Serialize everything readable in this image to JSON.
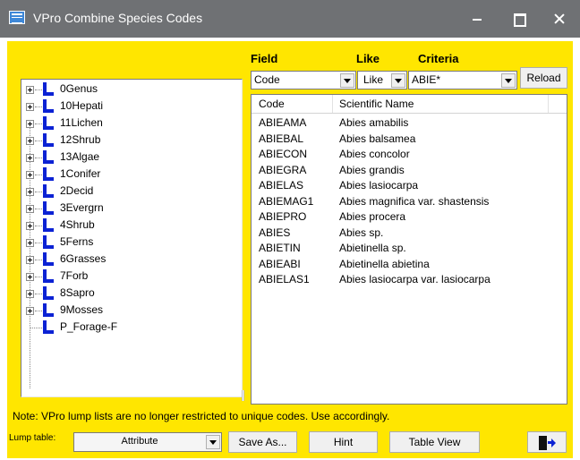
{
  "window": {
    "title": "VPro Combine Species Codes"
  },
  "colors": {
    "background": "#ffe600",
    "title_bar": "#6f7174",
    "lump_icon": "#0b22d4"
  },
  "tree": {
    "items": [
      {
        "label": "0Genus",
        "expandable": true
      },
      {
        "label": "10Hepati",
        "expandable": true
      },
      {
        "label": "11Lichen",
        "expandable": true
      },
      {
        "label": "12Shrub",
        "expandable": true
      },
      {
        "label": "13Algae",
        "expandable": true
      },
      {
        "label": "1Conifer",
        "expandable": true
      },
      {
        "label": "2Decid",
        "expandable": true
      },
      {
        "label": "3Evergrn",
        "expandable": true
      },
      {
        "label": "4Shrub",
        "expandable": true
      },
      {
        "label": "5Ferns",
        "expandable": true
      },
      {
        "label": "6Grasses",
        "expandable": true
      },
      {
        "label": "7Forb",
        "expandable": true
      },
      {
        "label": "8Sapro",
        "expandable": true
      },
      {
        "label": "9Mosses",
        "expandable": true
      },
      {
        "label": "P_Forage-F",
        "expandable": false
      }
    ]
  },
  "filter": {
    "field_label": "Field",
    "like_label": "Like",
    "criteria_label": "Criteria",
    "field_value": "Code",
    "like_value": "Like",
    "criteria_value": "ABIE*",
    "reload_label": "Reload"
  },
  "results": {
    "columns": [
      "Code",
      "Scientific Name"
    ],
    "rows": [
      {
        "code": "ABIEAMA",
        "name": "Abies amabilis"
      },
      {
        "code": "ABIEBAL",
        "name": "Abies balsamea"
      },
      {
        "code": "ABIECON",
        "name": "Abies concolor"
      },
      {
        "code": "ABIEGRA",
        "name": "Abies grandis"
      },
      {
        "code": "ABIELAS",
        "name": "Abies lasiocarpa"
      },
      {
        "code": "ABIEMAG1",
        "name": "Abies magnifica var. shastensis"
      },
      {
        "code": "ABIEPRO",
        "name": "Abies procera"
      },
      {
        "code": "ABIES",
        "name": "Abies sp."
      },
      {
        "code": "ABIETIN",
        "name": "Abietinella sp."
      },
      {
        "code": "ABIEABI",
        "name": "Abietinella abietina"
      },
      {
        "code": "ABIELAS1",
        "name": "Abies lasiocarpa var. lasiocarpa"
      }
    ]
  },
  "footer": {
    "note": "Note: VPro lump lists are no longer restricted to unique codes.  Use accordingly.",
    "lump_table_label": "Lump table:",
    "lump_table_value": "Attribute",
    "save_as_label": "Save As...",
    "hint_label": "Hint",
    "table_view_label": "Table View",
    "exit_icon": "exit-door-icon"
  }
}
